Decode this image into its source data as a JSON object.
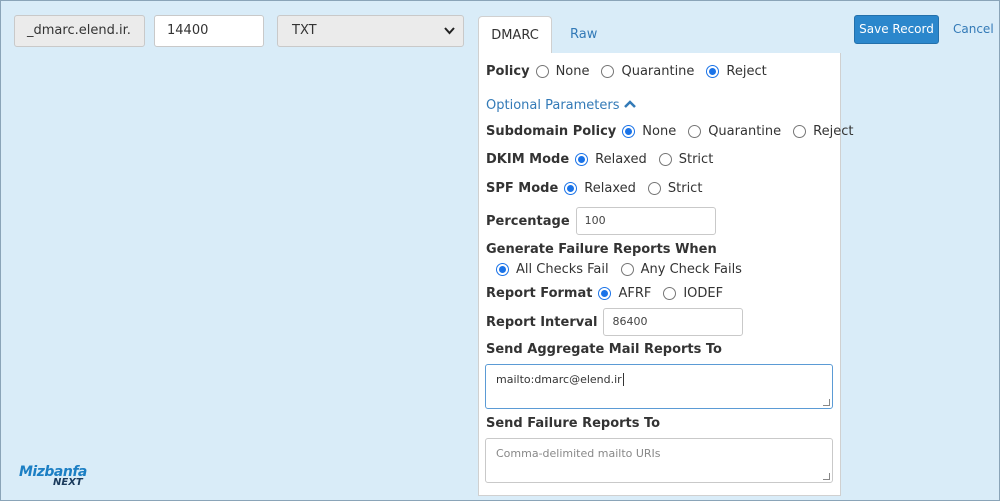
{
  "record": {
    "name": "_dmarc.elend.ir.",
    "ttl": "14400",
    "type": "TXT",
    "type_icon": "chevron-down-icon"
  },
  "tabs": [
    {
      "label": "DMARC",
      "active": true
    },
    {
      "label": "Raw",
      "active": false
    }
  ],
  "actions": {
    "save_label": "Save Record",
    "cancel_label": "Cancel"
  },
  "policy": {
    "label": "Policy",
    "options": [
      "None",
      "Quarantine",
      "Reject"
    ],
    "selected": "Reject"
  },
  "optional_params": {
    "label": "Optional Parameters",
    "icon": "chevron-up-icon"
  },
  "subdomain_policy": {
    "label": "Subdomain Policy",
    "options": [
      "None",
      "Quarantine",
      "Reject"
    ],
    "selected": "None"
  },
  "dkim_mode": {
    "label": "DKIM Mode",
    "options": [
      "Relaxed",
      "Strict"
    ],
    "selected": "Relaxed"
  },
  "spf_mode": {
    "label": "SPF Mode",
    "options": [
      "Relaxed",
      "Strict"
    ],
    "selected": "Relaxed"
  },
  "percentage": {
    "label": "Percentage",
    "value": "100"
  },
  "failure_reports_when": {
    "label": "Generate Failure Reports When",
    "options": [
      "All Checks Fail",
      "Any Check Fails"
    ],
    "selected": "All Checks Fail"
  },
  "report_format": {
    "label": "Report Format",
    "options": [
      "AFRF",
      "IODEF"
    ],
    "selected": "AFRF"
  },
  "report_interval": {
    "label": "Report Interval",
    "value": "86400"
  },
  "aggregate_reports": {
    "label": "Send Aggregate Mail Reports To",
    "value": "mailto:dmarc@elend.ir"
  },
  "failure_reports_to": {
    "label": "Send Failure Reports To",
    "placeholder": "Comma-delimited mailto URIs"
  },
  "logo": {
    "top": "Mizbanfa",
    "bottom": "NEXT"
  },
  "colors": {
    "background": "#d9ecf8",
    "accent": "#2b87cc",
    "link": "#337ab7",
    "radio_checked": "#1a73e8"
  }
}
